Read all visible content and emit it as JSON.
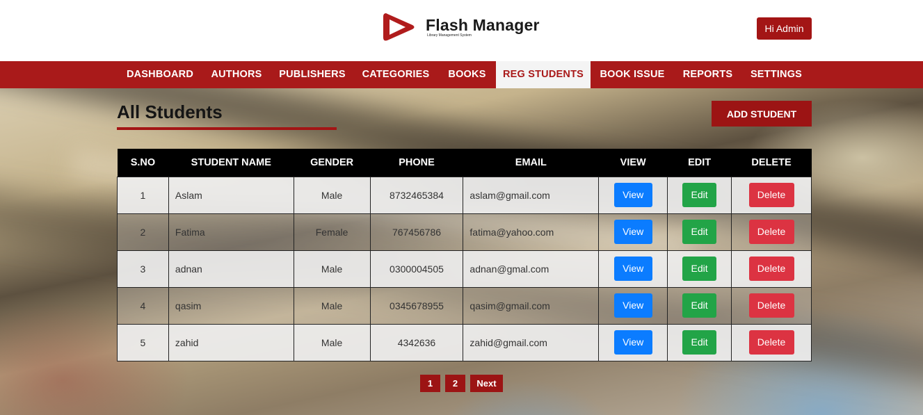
{
  "brand": {
    "name": "Flash Manager",
    "tagline": "Library Management System"
  },
  "header": {
    "admin_label": "Hi Admin"
  },
  "nav": {
    "items": [
      {
        "label": "DASHBOARD",
        "active": false
      },
      {
        "label": "AUTHORS",
        "active": false
      },
      {
        "label": "PUBLISHERS",
        "active": false
      },
      {
        "label": "CATEGORIES",
        "active": false
      },
      {
        "label": "BOOKS",
        "active": false
      },
      {
        "label": "REG STUDENTS",
        "active": true
      },
      {
        "label": "BOOK ISSUE",
        "active": false
      },
      {
        "label": "REPORTS",
        "active": false
      },
      {
        "label": "SETTINGS",
        "active": false
      }
    ]
  },
  "main": {
    "title": "All Students",
    "add_label": "ADD STUDENT",
    "columns": [
      "S.NO",
      "STUDENT NAME",
      "GENDER",
      "PHONE",
      "EMAIL",
      "VIEW",
      "EDIT",
      "DELETE"
    ],
    "rows": [
      {
        "sno": "1",
        "name": "Aslam",
        "gender": "Male",
        "phone": "8732465384",
        "email": "aslam@gmail.com",
        "view": "View",
        "edit": "Edit",
        "delete": "Delete"
      },
      {
        "sno": "2",
        "name": "Fatima",
        "gender": "Female",
        "phone": "767456786",
        "email": "fatima@yahoo.com",
        "view": "View",
        "edit": "Edit",
        "delete": "Delete"
      },
      {
        "sno": "3",
        "name": "adnan",
        "gender": "Male",
        "phone": "0300004505",
        "email": "adnan@gmal.com",
        "view": "View",
        "edit": "Edit",
        "delete": "Delete"
      },
      {
        "sno": "4",
        "name": "qasim",
        "gender": "Male",
        "phone": "0345678955",
        "email": "qasim@gmail.com",
        "view": "View",
        "edit": "Edit",
        "delete": "Delete"
      },
      {
        "sno": "5",
        "name": "zahid",
        "gender": "Male",
        "phone": "4342636",
        "email": "zahid@gmail.com",
        "view": "View",
        "edit": "Edit",
        "delete": "Delete"
      }
    ]
  },
  "pagination": {
    "pages": [
      "1",
      "2"
    ],
    "next_label": "Next"
  },
  "colors": {
    "brand_red": "#a91a1a",
    "view_blue": "#0b7cff",
    "edit_green": "#22a447",
    "delete_red": "#dc3342"
  }
}
